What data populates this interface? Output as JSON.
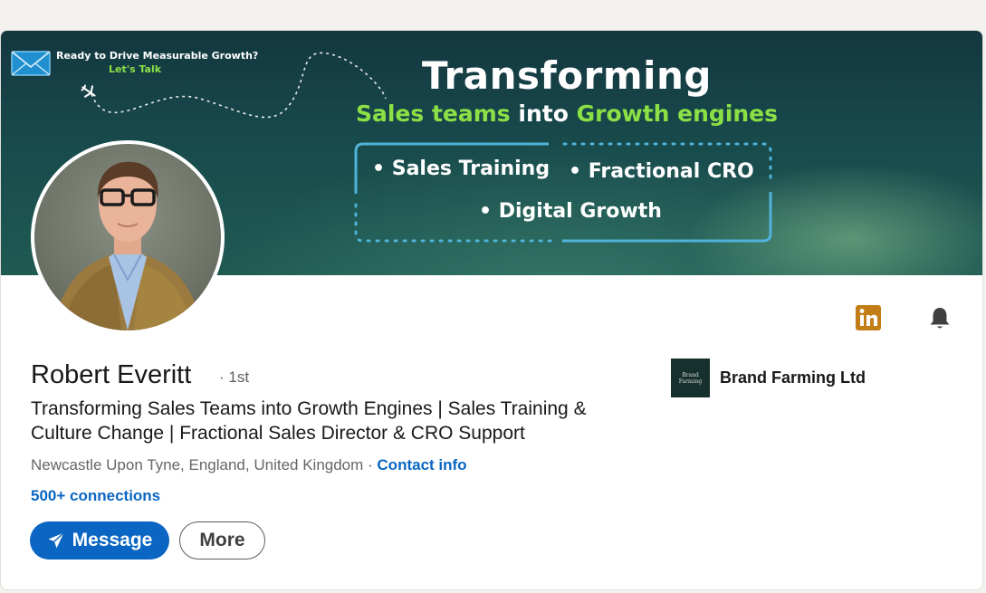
{
  "banner": {
    "cta_line1": "Ready to Drive Measurable Growth?",
    "cta_line2": "Let's Talk",
    "title": "Transforming",
    "subtitle_part1": "Sales teams",
    "subtitle_part2": "into",
    "subtitle_part3": "Growth engines",
    "services": [
      "• Sales Training",
      "• Fractional CRO",
      "• Digital Growth"
    ],
    "colors": {
      "accent_green": "#8be046",
      "frame_blue": "#4fb3d9"
    }
  },
  "profile": {
    "name": "Robert Everitt",
    "degree": "· 1st",
    "headline": "Transforming Sales Teams into Growth Engines | Sales Training & Culture Change | Fractional Sales Director & CRO Support",
    "location": "Newcastle Upon Tyne, England, United Kingdom",
    "location_sep": " · ",
    "contact_info": "Contact info",
    "connections": "500+ connections"
  },
  "actions": {
    "message_label": "Message",
    "more_label": "More"
  },
  "company": {
    "name": "Brand Farming Ltd",
    "logo_text": "Brand Farming"
  },
  "icons": {
    "linkedin": "linkedin-icon",
    "bell": "bell-icon",
    "send": "paper-plane-icon",
    "envelope": "envelope-icon",
    "airplane": "airplane-icon"
  },
  "colors": {
    "primary": "#0a66c2",
    "linkedin_badge": "#c37d16"
  }
}
